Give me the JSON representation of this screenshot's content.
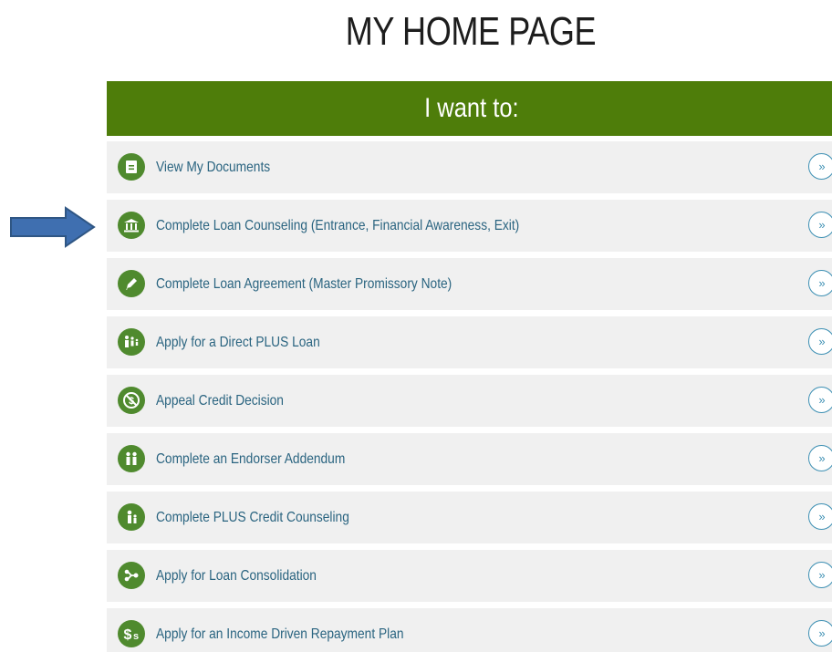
{
  "page": {
    "title": "MY HOME PAGE"
  },
  "panel": {
    "header": "I want to:",
    "items": [
      {
        "label": "View My Documents",
        "icon": "document-icon"
      },
      {
        "label": "Complete Loan Counseling (Entrance, Financial Awareness, Exit)",
        "icon": "bank-icon"
      },
      {
        "label": "Complete Loan Agreement (Master Promissory Note)",
        "icon": "pencil-icon"
      },
      {
        "label": "Apply for a Direct PLUS Loan",
        "icon": "family-icon"
      },
      {
        "label": "Appeal Credit Decision",
        "icon": "no-dollar-icon"
      },
      {
        "label": "Complete an Endorser Addendum",
        "icon": "two-people-icon"
      },
      {
        "label": "Complete PLUS Credit Counseling",
        "icon": "parent-child-icon"
      },
      {
        "label": "Apply for Loan Consolidation",
        "icon": "merge-icon"
      },
      {
        "label": "Apply for an Income Driven Repayment Plan",
        "icon": "dollar-icon"
      }
    ],
    "go_glyph": "»"
  },
  "colors": {
    "header_bg": "#4e7d0a",
    "row_bg": "#f0f0f0",
    "icon_bg": "#4f8a2e",
    "link_text": "#2a6480",
    "button_ring": "#3c8fb3",
    "annotation_arrow": "#3f6fb0"
  }
}
